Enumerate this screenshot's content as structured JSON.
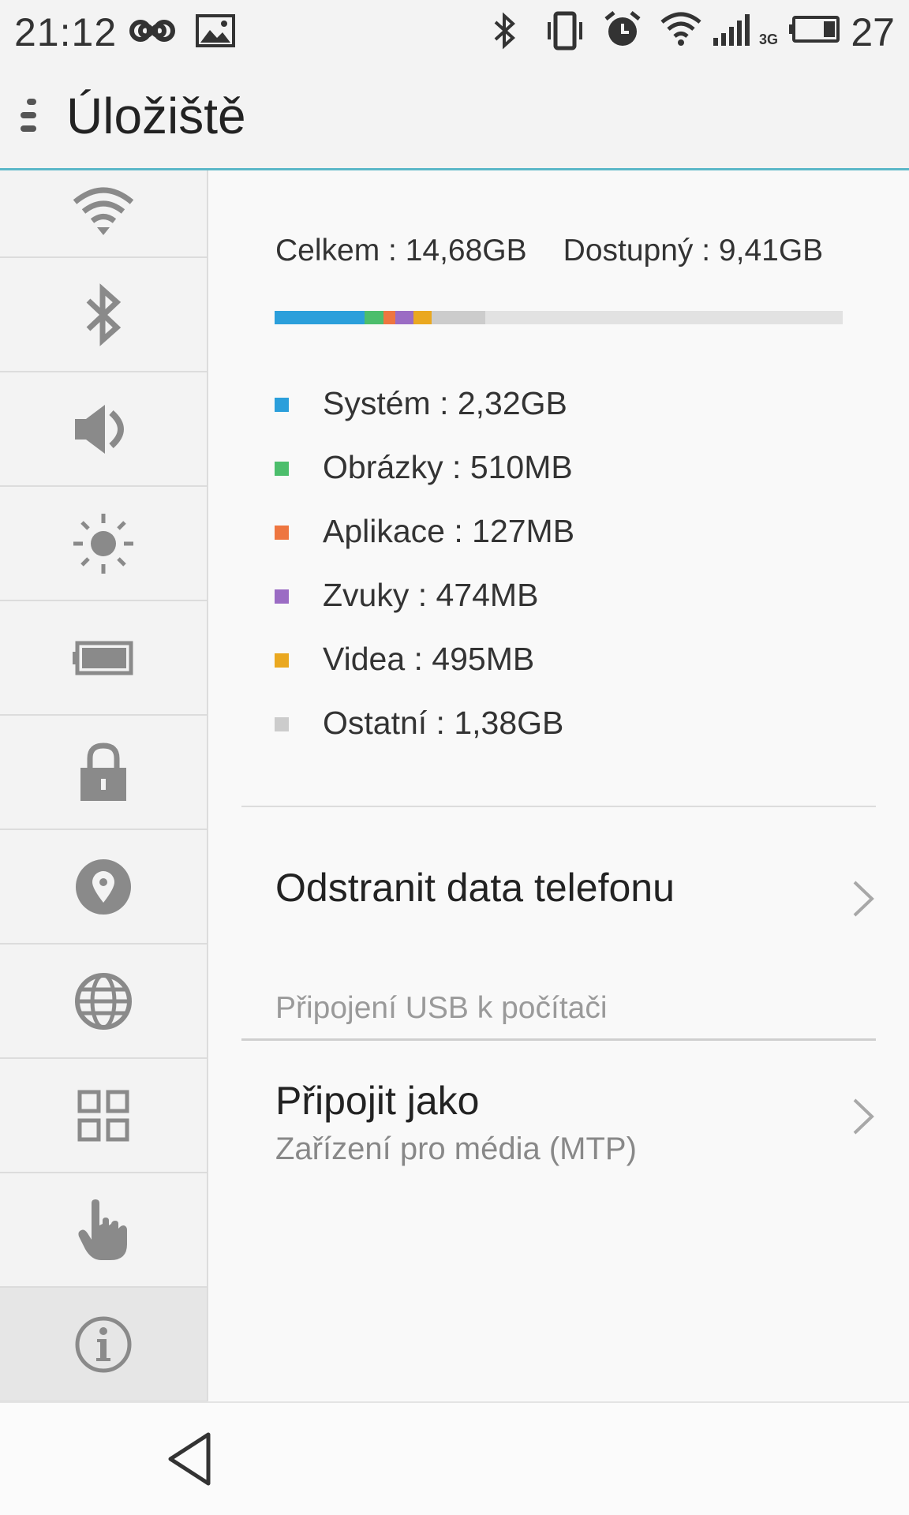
{
  "status_bar": {
    "time": "21:12",
    "battery_level": "27",
    "network_type": "3G",
    "icons": [
      "infinity-icon",
      "image-icon",
      "bluetooth-icon",
      "vibrate-icon",
      "alarm-icon",
      "wifi-icon",
      "signal-icon",
      "battery-icon"
    ]
  },
  "header": {
    "title": "Úložiště",
    "menu_icon": "menu-icon"
  },
  "sidebar": {
    "items": [
      {
        "icon": "wifi-icon",
        "active": false
      },
      {
        "icon": "bluetooth-icon",
        "active": false
      },
      {
        "icon": "volume-icon",
        "active": false
      },
      {
        "icon": "brightness-icon",
        "active": false
      },
      {
        "icon": "battery-icon",
        "active": false
      },
      {
        "icon": "lock-icon",
        "active": false
      },
      {
        "icon": "location-pin-icon",
        "active": false
      },
      {
        "icon": "globe-icon",
        "active": false
      },
      {
        "icon": "apps-grid-icon",
        "active": false
      },
      {
        "icon": "hand-gesture-icon",
        "active": false
      },
      {
        "icon": "info-icon",
        "active": true
      }
    ]
  },
  "storage": {
    "total": "Celkem : 14,68GB",
    "available": "Dostupný : 9,41GB",
    "categories": [
      {
        "label": "Systém : 2,32GB",
        "color": "#2b9fdb",
        "fraction": 0.158
      },
      {
        "label": "Obrázky : 510MB",
        "color": "#4cbe6c",
        "fraction": 0.034
      },
      {
        "label": "Aplikace : 127MB",
        "color": "#ee7640",
        "fraction": 0.02
      },
      {
        "label": "Zvuky : 474MB",
        "color": "#9b6cc4",
        "fraction": 0.032
      },
      {
        "label": "Videa : 495MB",
        "color": "#eaa820",
        "fraction": 0.033
      },
      {
        "label": "Ostatní : 1,38GB",
        "color": "#cccccc",
        "fraction": 0.094
      }
    ]
  },
  "actions": {
    "erase_data": "Odstranit data telefonu",
    "usb_section_header": "Připojení USB k počítači",
    "connect_as_title": "Připojit jako",
    "connect_as_value": "Zařízení pro média (MTP)"
  },
  "bottom_nav": {
    "back_icon": "back-triangle-icon"
  }
}
